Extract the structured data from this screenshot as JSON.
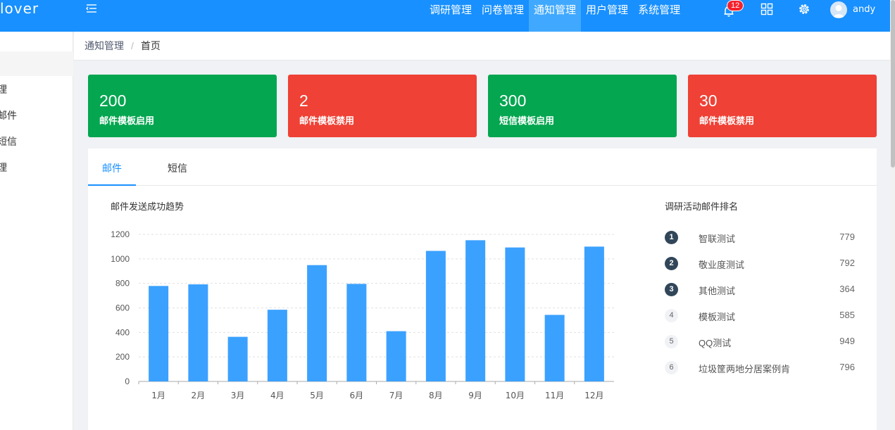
{
  "header": {
    "logo": "lover",
    "nav": [
      "调研管理",
      "问卷管理",
      "通知管理",
      "用户管理",
      "系统管理"
    ],
    "active_nav": 2,
    "notification_count": "12",
    "username": "andy",
    "bg_color": "#1890ff"
  },
  "sidebar": {
    "items": [
      "理",
      "邮件",
      "短信",
      "理"
    ]
  },
  "breadcrumb": {
    "items": [
      "通知管理",
      "首页"
    ]
  },
  "cards": [
    {
      "value": "200",
      "label": "邮件模板启用",
      "color": "#04a650"
    },
    {
      "value": "2",
      "label": "邮件模板禁用",
      "color": "#ef4135"
    },
    {
      "value": "300",
      "label": "短信模板启用",
      "color": "#04a650"
    },
    {
      "value": "30",
      "label": "邮件模板禁用",
      "color": "#ef4135"
    }
  ],
  "tabs": {
    "items": [
      "邮件",
      "短信"
    ],
    "active": 0
  },
  "chart_title": "邮件发送成功趋势",
  "chart_data": {
    "type": "bar",
    "categories": [
      "1月",
      "2月",
      "3月",
      "4月",
      "5月",
      "6月",
      "7月",
      "8月",
      "9月",
      "10月",
      "11月",
      "12月"
    ],
    "values": [
      779,
      792,
      364,
      585,
      949,
      796,
      410,
      1065,
      1152,
      1093,
      543,
      1100
    ],
    "ylim": [
      0,
      1200
    ],
    "yticks": [
      0,
      200,
      400,
      600,
      800,
      1000,
      1200
    ],
    "grid": true,
    "bar_color": "#3ba1ff"
  },
  "ranking": {
    "title": "调研活动邮件排名",
    "items": [
      {
        "rank": "1",
        "name": "智联测试",
        "value": "779"
      },
      {
        "rank": "2",
        "name": "敬业度测试",
        "value": "792"
      },
      {
        "rank": "3",
        "name": "其他测试",
        "value": "364"
      },
      {
        "rank": "4",
        "name": "模板测试",
        "value": "585"
      },
      {
        "rank": "5",
        "name": "QQ测试",
        "value": "949"
      },
      {
        "rank": "6",
        "name": "垃圾筐两地分居案例肯",
        "value": "796"
      }
    ]
  }
}
